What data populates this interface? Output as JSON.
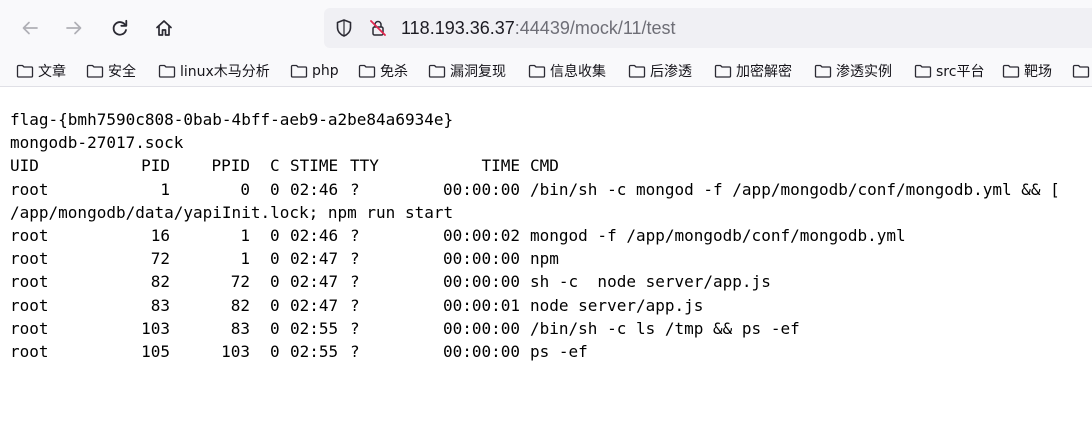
{
  "browser": {
    "url": {
      "host": "118.193.36.37",
      "port": ":44439",
      "path": "/mock/11/test"
    },
    "icons": [
      "back-arrow-icon",
      "forward-arrow-icon",
      "reload-icon",
      "home-icon",
      "shield-icon",
      "insecure-lock-icon",
      "folder-icon"
    ],
    "bookmarks": [
      {
        "label": "文章"
      },
      {
        "label": "安全"
      },
      {
        "label": "linux木马分析"
      },
      {
        "label": "php"
      },
      {
        "label": "免杀"
      },
      {
        "label": "漏洞复现"
      },
      {
        "label": "信息收集"
      },
      {
        "label": "后渗透"
      },
      {
        "label": "加密解密"
      },
      {
        "label": "渗透实例"
      },
      {
        "label": "src平台"
      },
      {
        "label": "靶场"
      }
    ]
  },
  "output": {
    "flag": "flag-{bmh7590c808-0bab-4bff-aeb9-a2be84a6934e}",
    "sock": "mongodb-27017.sock",
    "ps_header": {
      "uid": "UID",
      "pid": "PID",
      "ppid": "PPID",
      "c": "C",
      "stime": "STIME",
      "tty": "TTY",
      "time": "TIME",
      "cmd": "CMD"
    },
    "ps_rows": [
      {
        "uid": "root",
        "pid": "1",
        "ppid": "0",
        "c": "0",
        "stime": "02:46",
        "tty": "?",
        "time": "00:00:00",
        "cmd": "/bin/sh -c mongod -f /app/mongodb/conf/mongodb.yml && ["
      },
      {
        "wrap": "/app/mongodb/data/yapiInit.lock; npm run start"
      },
      {
        "uid": "root",
        "pid": "16",
        "ppid": "1",
        "c": "0",
        "stime": "02:46",
        "tty": "?",
        "time": "00:00:02",
        "cmd": "mongod -f /app/mongodb/conf/mongodb.yml"
      },
      {
        "uid": "root",
        "pid": "72",
        "ppid": "1",
        "c": "0",
        "stime": "02:47",
        "tty": "?",
        "time": "00:00:00",
        "cmd": "npm"
      },
      {
        "uid": "root",
        "pid": "82",
        "ppid": "72",
        "c": "0",
        "stime": "02:47",
        "tty": "?",
        "time": "00:00:00",
        "cmd": "sh -c  node server/app.js"
      },
      {
        "uid": "root",
        "pid": "83",
        "ppid": "82",
        "c": "0",
        "stime": "02:47",
        "tty": "?",
        "time": "00:00:01",
        "cmd": "node server/app.js"
      },
      {
        "uid": "root",
        "pid": "103",
        "ppid": "83",
        "c": "0",
        "stime": "02:55",
        "tty": "?",
        "time": "00:00:00",
        "cmd": "/bin/sh -c ls /tmp && ps -ef"
      },
      {
        "uid": "root",
        "pid": "105",
        "ppid": "103",
        "c": "0",
        "stime": "02:55",
        "tty": "?",
        "time": "00:00:00",
        "cmd": "ps -ef"
      }
    ]
  }
}
